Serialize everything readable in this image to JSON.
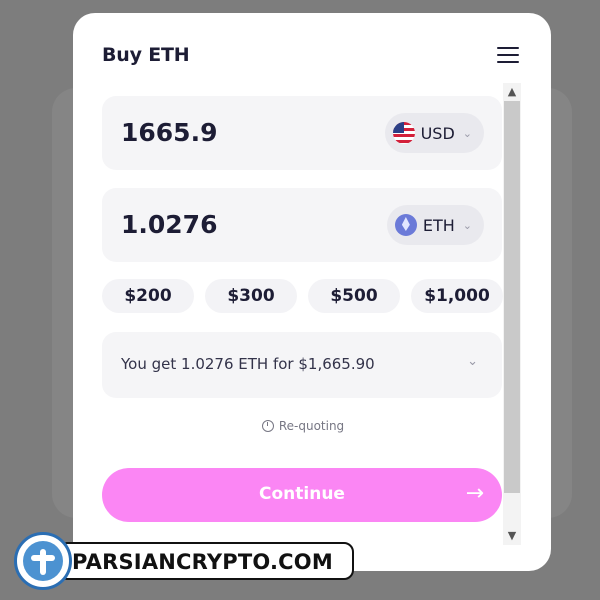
{
  "header": {
    "title": "Buy ETH",
    "menu_icon": "hamburger-menu-icon"
  },
  "fiat": {
    "amount": "1665.9",
    "currency": "USD",
    "flag_icon": "us-flag-icon"
  },
  "crypto": {
    "amount": "1.0276",
    "currency": "ETH",
    "coin_icon": "ethereum-icon"
  },
  "quick_amounts": [
    "$200",
    "$300",
    "$500",
    "$1,000"
  ],
  "summary": {
    "text": "You get 1.0276 ETH for $1,665.90"
  },
  "status": {
    "requote_text": "Re-quoting"
  },
  "cta": {
    "label": "Continue",
    "color": "#fb86f4"
  },
  "watermark": {
    "text": "PARSIANCRYPTO.COM"
  },
  "colors": {
    "accent": "#fb86f4",
    "text": "#1d1d35",
    "field_bg": "#f5f5f7"
  }
}
